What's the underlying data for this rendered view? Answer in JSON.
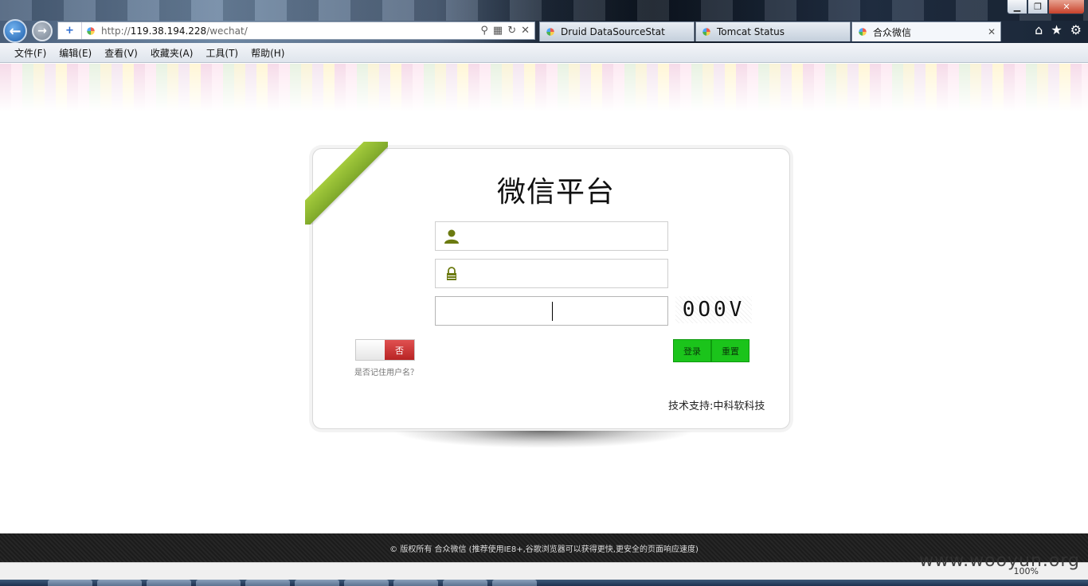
{
  "window": {
    "minimize": "▁",
    "restore": "❐",
    "close": "✕"
  },
  "addressbar": {
    "url_prefix": "http://",
    "url_host": "119.38.194.228",
    "url_path": "/wechat/"
  },
  "tabs": [
    {
      "label": "Druid DataSourceStat",
      "active": false
    },
    {
      "label": "Tomcat Status",
      "active": false
    },
    {
      "label": "合众微信",
      "active": true,
      "close": "✕"
    }
  ],
  "menubar": {
    "items": [
      "文件(F)",
      "编辑(E)",
      "查看(V)",
      "收藏夹(A)",
      "工具(T)",
      "帮助(H)"
    ]
  },
  "login": {
    "title": "微信平台",
    "username_value": "",
    "password_value": "",
    "captcha_value": "",
    "captcha_image_text": "0O0V",
    "remember_toggle_label": "否",
    "remember_hint": "是否记住用户名？",
    "login_button": "登录",
    "reset_button": "重置",
    "support_text": "技术支持:中科软科技"
  },
  "footer": {
    "text": "© 版权所有 合众微信 (推荐使用IE8+,谷歌浏览器可以获得更快,更安全的页面响应速度)"
  },
  "statusbar": {
    "zoom": "100%",
    "watermark": "www.wooyun.org"
  },
  "colors": {
    "ribbon": "#8fbb31",
    "button_green": "#1bc41b",
    "toggle_red": "#c83030",
    "footer_bg": "#222222"
  }
}
